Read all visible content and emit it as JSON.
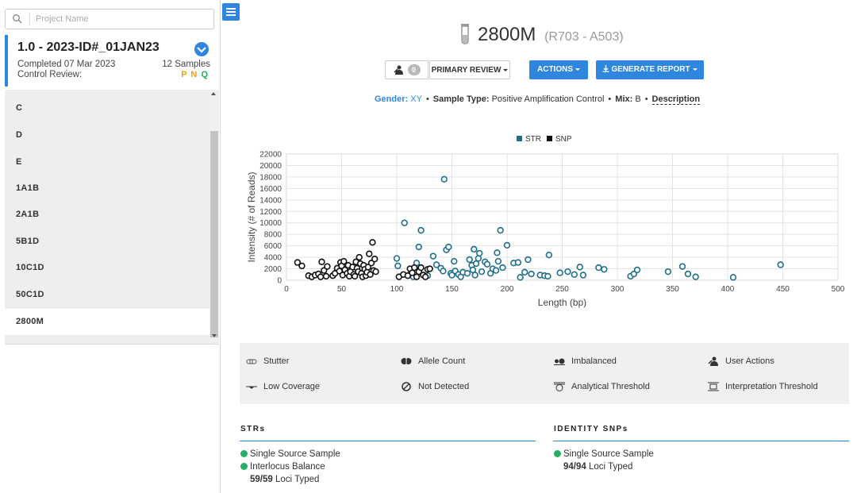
{
  "search": {
    "placeholder": "Project Name"
  },
  "project": {
    "version": "1.0",
    "name": "2023-ID#_01JAN23",
    "completed": "Completed 07 Mar 2023",
    "samples": "12 Samples",
    "review_label": "Control Review:",
    "review_flags": [
      "P",
      "N",
      "Q"
    ]
  },
  "sample_list": [
    "C",
    "D",
    "E",
    "1A1B",
    "2A1B",
    "5B1D",
    "10C1D",
    "50C1D",
    "2800M"
  ],
  "sample": {
    "name": "2800M",
    "indexes": "(R703 - A503)",
    "user_actions_count": "0"
  },
  "toolbar": {
    "primary_review": "PRIMARY REVIEW",
    "actions": "ACTIONS",
    "generate_report": "GENERATE REPORT"
  },
  "meta": {
    "gender_label": "Gender:",
    "gender_value": "XY",
    "sample_type_label": "Sample Type:",
    "sample_type_value": "Positive Amplification Control",
    "mix_label": "Mix:",
    "mix_value": "B",
    "description": "Description"
  },
  "colors": {
    "accent": "#2e86de",
    "str": "#1f6e8c",
    "snp": "#111111",
    "ok": "#27ae60",
    "flag_orange": "#f39c12"
  },
  "chart_data": {
    "type": "scatter",
    "xlabel": "Length (bp)",
    "ylabel": "Intensity (# of Reads)",
    "xlim": [
      0,
      500
    ],
    "ylim": [
      0,
      22000
    ],
    "xticks": [
      0,
      50,
      100,
      150,
      200,
      250,
      300,
      350,
      400,
      450,
      500
    ],
    "yticks": [
      0,
      2000,
      4000,
      6000,
      8000,
      10000,
      12000,
      14000,
      16000,
      18000,
      20000,
      22000
    ],
    "grid": true,
    "legend_position": "top-center",
    "series": [
      {
        "name": "STR",
        "points": [
          [
            100,
            3800
          ],
          [
            101,
            2500
          ],
          [
            107,
            10000
          ],
          [
            112,
            1000
          ],
          [
            115,
            600
          ],
          [
            118,
            3000
          ],
          [
            120,
            5800
          ],
          [
            122,
            8700
          ],
          [
            128,
            800
          ],
          [
            133,
            4200
          ],
          [
            136,
            2700
          ],
          [
            140,
            2100
          ],
          [
            142,
            1600
          ],
          [
            143,
            17600
          ],
          [
            145,
            5300
          ],
          [
            147,
            5800
          ],
          [
            149,
            1200
          ],
          [
            150,
            900
          ],
          [
            152,
            3300
          ],
          [
            153,
            1600
          ],
          [
            156,
            1000
          ],
          [
            158,
            600
          ],
          [
            160,
            1400
          ],
          [
            164,
            1200
          ],
          [
            166,
            3600
          ],
          [
            168,
            2600
          ],
          [
            169,
            1800
          ],
          [
            170,
            5400
          ],
          [
            171,
            900
          ],
          [
            172,
            2900
          ],
          [
            174,
            3800
          ],
          [
            175,
            4700
          ],
          [
            177,
            1500
          ],
          [
            180,
            3200
          ],
          [
            182,
            2800
          ],
          [
            185,
            1200
          ],
          [
            187,
            2000
          ],
          [
            190,
            1700
          ],
          [
            191,
            4800
          ],
          [
            192,
            3300
          ],
          [
            194,
            8700
          ],
          [
            196,
            2200
          ],
          [
            200,
            6100
          ],
          [
            206,
            3000
          ],
          [
            210,
            3100
          ],
          [
            212,
            500
          ],
          [
            216,
            1400
          ],
          [
            219,
            3600
          ],
          [
            222,
            1100
          ],
          [
            230,
            900
          ],
          [
            234,
            800
          ],
          [
            237,
            700
          ],
          [
            238,
            4400
          ],
          [
            248,
            1300
          ],
          [
            255,
            1500
          ],
          [
            261,
            1000
          ],
          [
            266,
            2300
          ],
          [
            269,
            900
          ],
          [
            283,
            2200
          ],
          [
            288,
            1900
          ],
          [
            312,
            700
          ],
          [
            315,
            1100
          ],
          [
            318,
            1800
          ],
          [
            346,
            1500
          ],
          [
            359,
            2400
          ],
          [
            364,
            1100
          ],
          [
            371,
            600
          ],
          [
            405,
            500
          ],
          [
            448,
            2700
          ]
        ]
      },
      {
        "name": "SNP",
        "points": [
          [
            10,
            3100
          ],
          [
            14,
            2500
          ],
          [
            20,
            800
          ],
          [
            23,
            600
          ],
          [
            26,
            900
          ],
          [
            29,
            1100
          ],
          [
            31,
            600
          ],
          [
            32,
            3200
          ],
          [
            34,
            1700
          ],
          [
            36,
            700
          ],
          [
            37,
            2400
          ],
          [
            42,
            800
          ],
          [
            44,
            1200
          ],
          [
            46,
            2100
          ],
          [
            48,
            1600
          ],
          [
            49,
            3100
          ],
          [
            50,
            2500
          ],
          [
            51,
            900
          ],
          [
            52,
            3300
          ],
          [
            53,
            1800
          ],
          [
            55,
            1200
          ],
          [
            56,
            2600
          ],
          [
            57,
            700
          ],
          [
            58,
            1500
          ],
          [
            60,
            2300
          ],
          [
            61,
            1000
          ],
          [
            62,
            700
          ],
          [
            63,
            3200
          ],
          [
            64,
            2100
          ],
          [
            65,
            1500
          ],
          [
            66,
            4000
          ],
          [
            67,
            2900
          ],
          [
            68,
            1200
          ],
          [
            69,
            600
          ],
          [
            70,
            2600
          ],
          [
            71,
            1900
          ],
          [
            72,
            800
          ],
          [
            73,
            1400
          ],
          [
            74,
            2300
          ],
          [
            75,
            4600
          ],
          [
            76,
            1000
          ],
          [
            77,
            3000
          ],
          [
            78,
            6600
          ],
          [
            79,
            1700
          ],
          [
            80,
            3700
          ],
          [
            81,
            1500
          ],
          [
            102,
            600
          ],
          [
            106,
            1000
          ],
          [
            110,
            800
          ],
          [
            112,
            2000
          ],
          [
            114,
            1300
          ],
          [
            116,
            2200
          ],
          [
            118,
            600
          ],
          [
            120,
            1500
          ],
          [
            122,
            2200
          ],
          [
            124,
            900
          ],
          [
            126,
            600
          ],
          [
            128,
            1900
          ],
          [
            130,
            2000
          ]
        ]
      }
    ]
  },
  "legend": [
    "Stutter",
    "Allele Count",
    "Imbalanced",
    "User Actions",
    "Low Coverage",
    "Not Detected",
    "Analytical Threshold",
    "Interpretation Threshold"
  ],
  "strs": {
    "title": "STRs",
    "item1": "Single Source Sample",
    "item2": "Interlocus Balance",
    "loci_count": "59/59",
    "loci_label": "Loci Typed"
  },
  "snps": {
    "title": "IDENTITY SNPs",
    "item1": "Single Source Sample",
    "loci_count": "94/94",
    "loci_label": "Loci Typed"
  }
}
